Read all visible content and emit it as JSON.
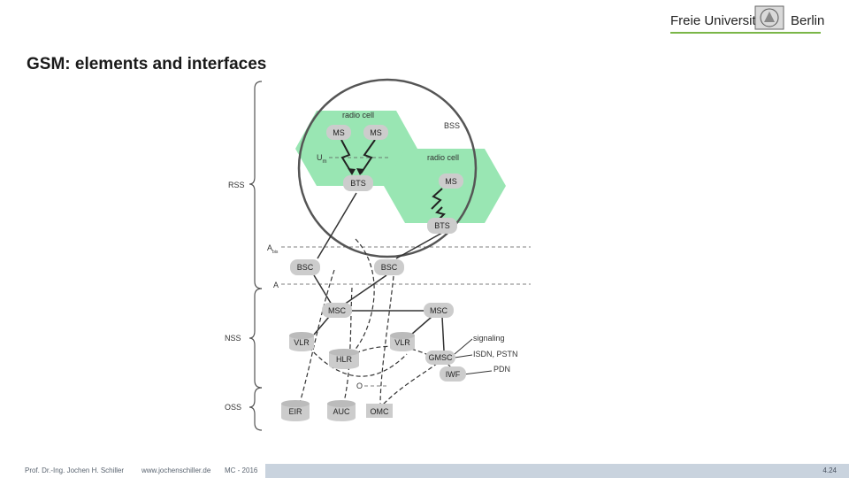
{
  "header": {
    "logo_left": "Freie Universität",
    "logo_right": "Berlin",
    "title": "GSM: elements and interfaces"
  },
  "colors": {
    "cell_fill": "#99e6b3",
    "node_fill": "#cccccc",
    "brand_green": "#7ab648",
    "footer_bar": "#c9d3de"
  },
  "groups": {
    "rss": "RSS",
    "nss": "NSS",
    "oss": "OSS"
  },
  "interfaces": {
    "um": "U",
    "um_sub": "m",
    "abis": "A",
    "abis_sub": "bis",
    "a": "A",
    "o": "O"
  },
  "labels": {
    "radio_cell_1": "radio cell",
    "radio_cell_2": "radio cell",
    "bss": "BSS",
    "signaling": "signaling",
    "isdn": "ISDN, PSTN",
    "pdn": "PDN"
  },
  "nodes": {
    "ms1": "MS",
    "ms2": "MS",
    "ms3": "MS",
    "bts1": "BTS",
    "bts2": "BTS",
    "bsc1": "BSC",
    "bsc2": "BSC",
    "msc1": "MSC",
    "msc2": "MSC",
    "vlr1": "VLR",
    "vlr2": "VLR",
    "hlr": "HLR",
    "gmsc": "GMSC",
    "iwf": "IWF",
    "eir": "EIR",
    "auc": "AUC",
    "omc": "OMC"
  },
  "footer": {
    "author": "Prof. Dr.-Ing. Jochen H. Schiller",
    "url": "www.jochenschiller.de",
    "course": "MC - 2016",
    "page": "4.24"
  }
}
